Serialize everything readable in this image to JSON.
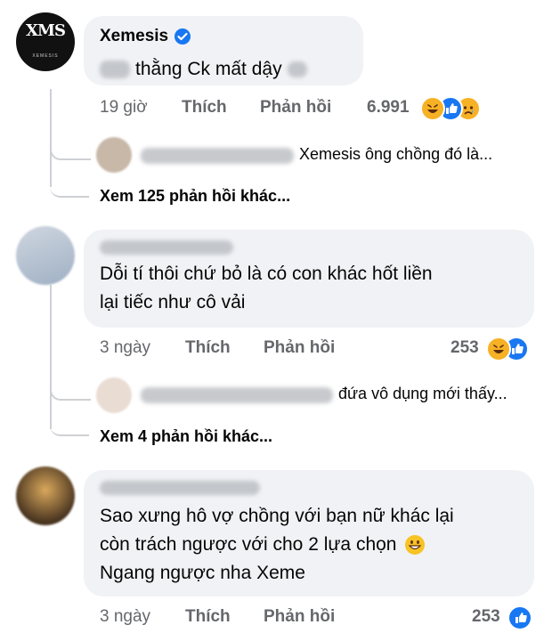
{
  "comments": [
    {
      "author": "Xemesis",
      "avatar_logo": "XMS",
      "avatar_sub": "XEMESIS",
      "text": "thằng Ck mất dậy",
      "time": "19 giờ",
      "like_label": "Thích",
      "reply_label": "Phản hồi",
      "reaction_count": "6.991",
      "reactions": [
        "haha-icon",
        "like-icon",
        "sad-icon"
      ],
      "preview_reply_text": "Xemesis ông chồng đó là...",
      "more_replies": "Xem 125 phản hồi khác..."
    },
    {
      "text_line1": "Dỗi tí thôi chứ bỏ là có con khác hốt liền",
      "text_line2": "lại tiếc như cô vải",
      "time": "3 ngày",
      "like_label": "Thích",
      "reply_label": "Phản hồi",
      "reaction_count": "253",
      "reactions": [
        "haha-icon",
        "like-icon"
      ],
      "preview_reply_text": "đứa vô dụng mới thấy...",
      "more_replies": "Xem 4 phản hồi khác..."
    },
    {
      "text_line1": "Sao xưng hô vợ chồng với bạn nữ khác lại",
      "text_line2": "còn trách ngược với cho 2 lựa chọn",
      "text_line3": "Ngang ngược nha Xeme",
      "time": "3 ngày",
      "like_label": "Thích",
      "reply_label": "Phản hồi",
      "reaction_count": "253",
      "reactions": [
        "like-icon"
      ]
    }
  ],
  "colors": {
    "like": "#1877f2",
    "haha": "#f7b125",
    "bubble": "#f0f2f5",
    "meta": "#65676b"
  }
}
